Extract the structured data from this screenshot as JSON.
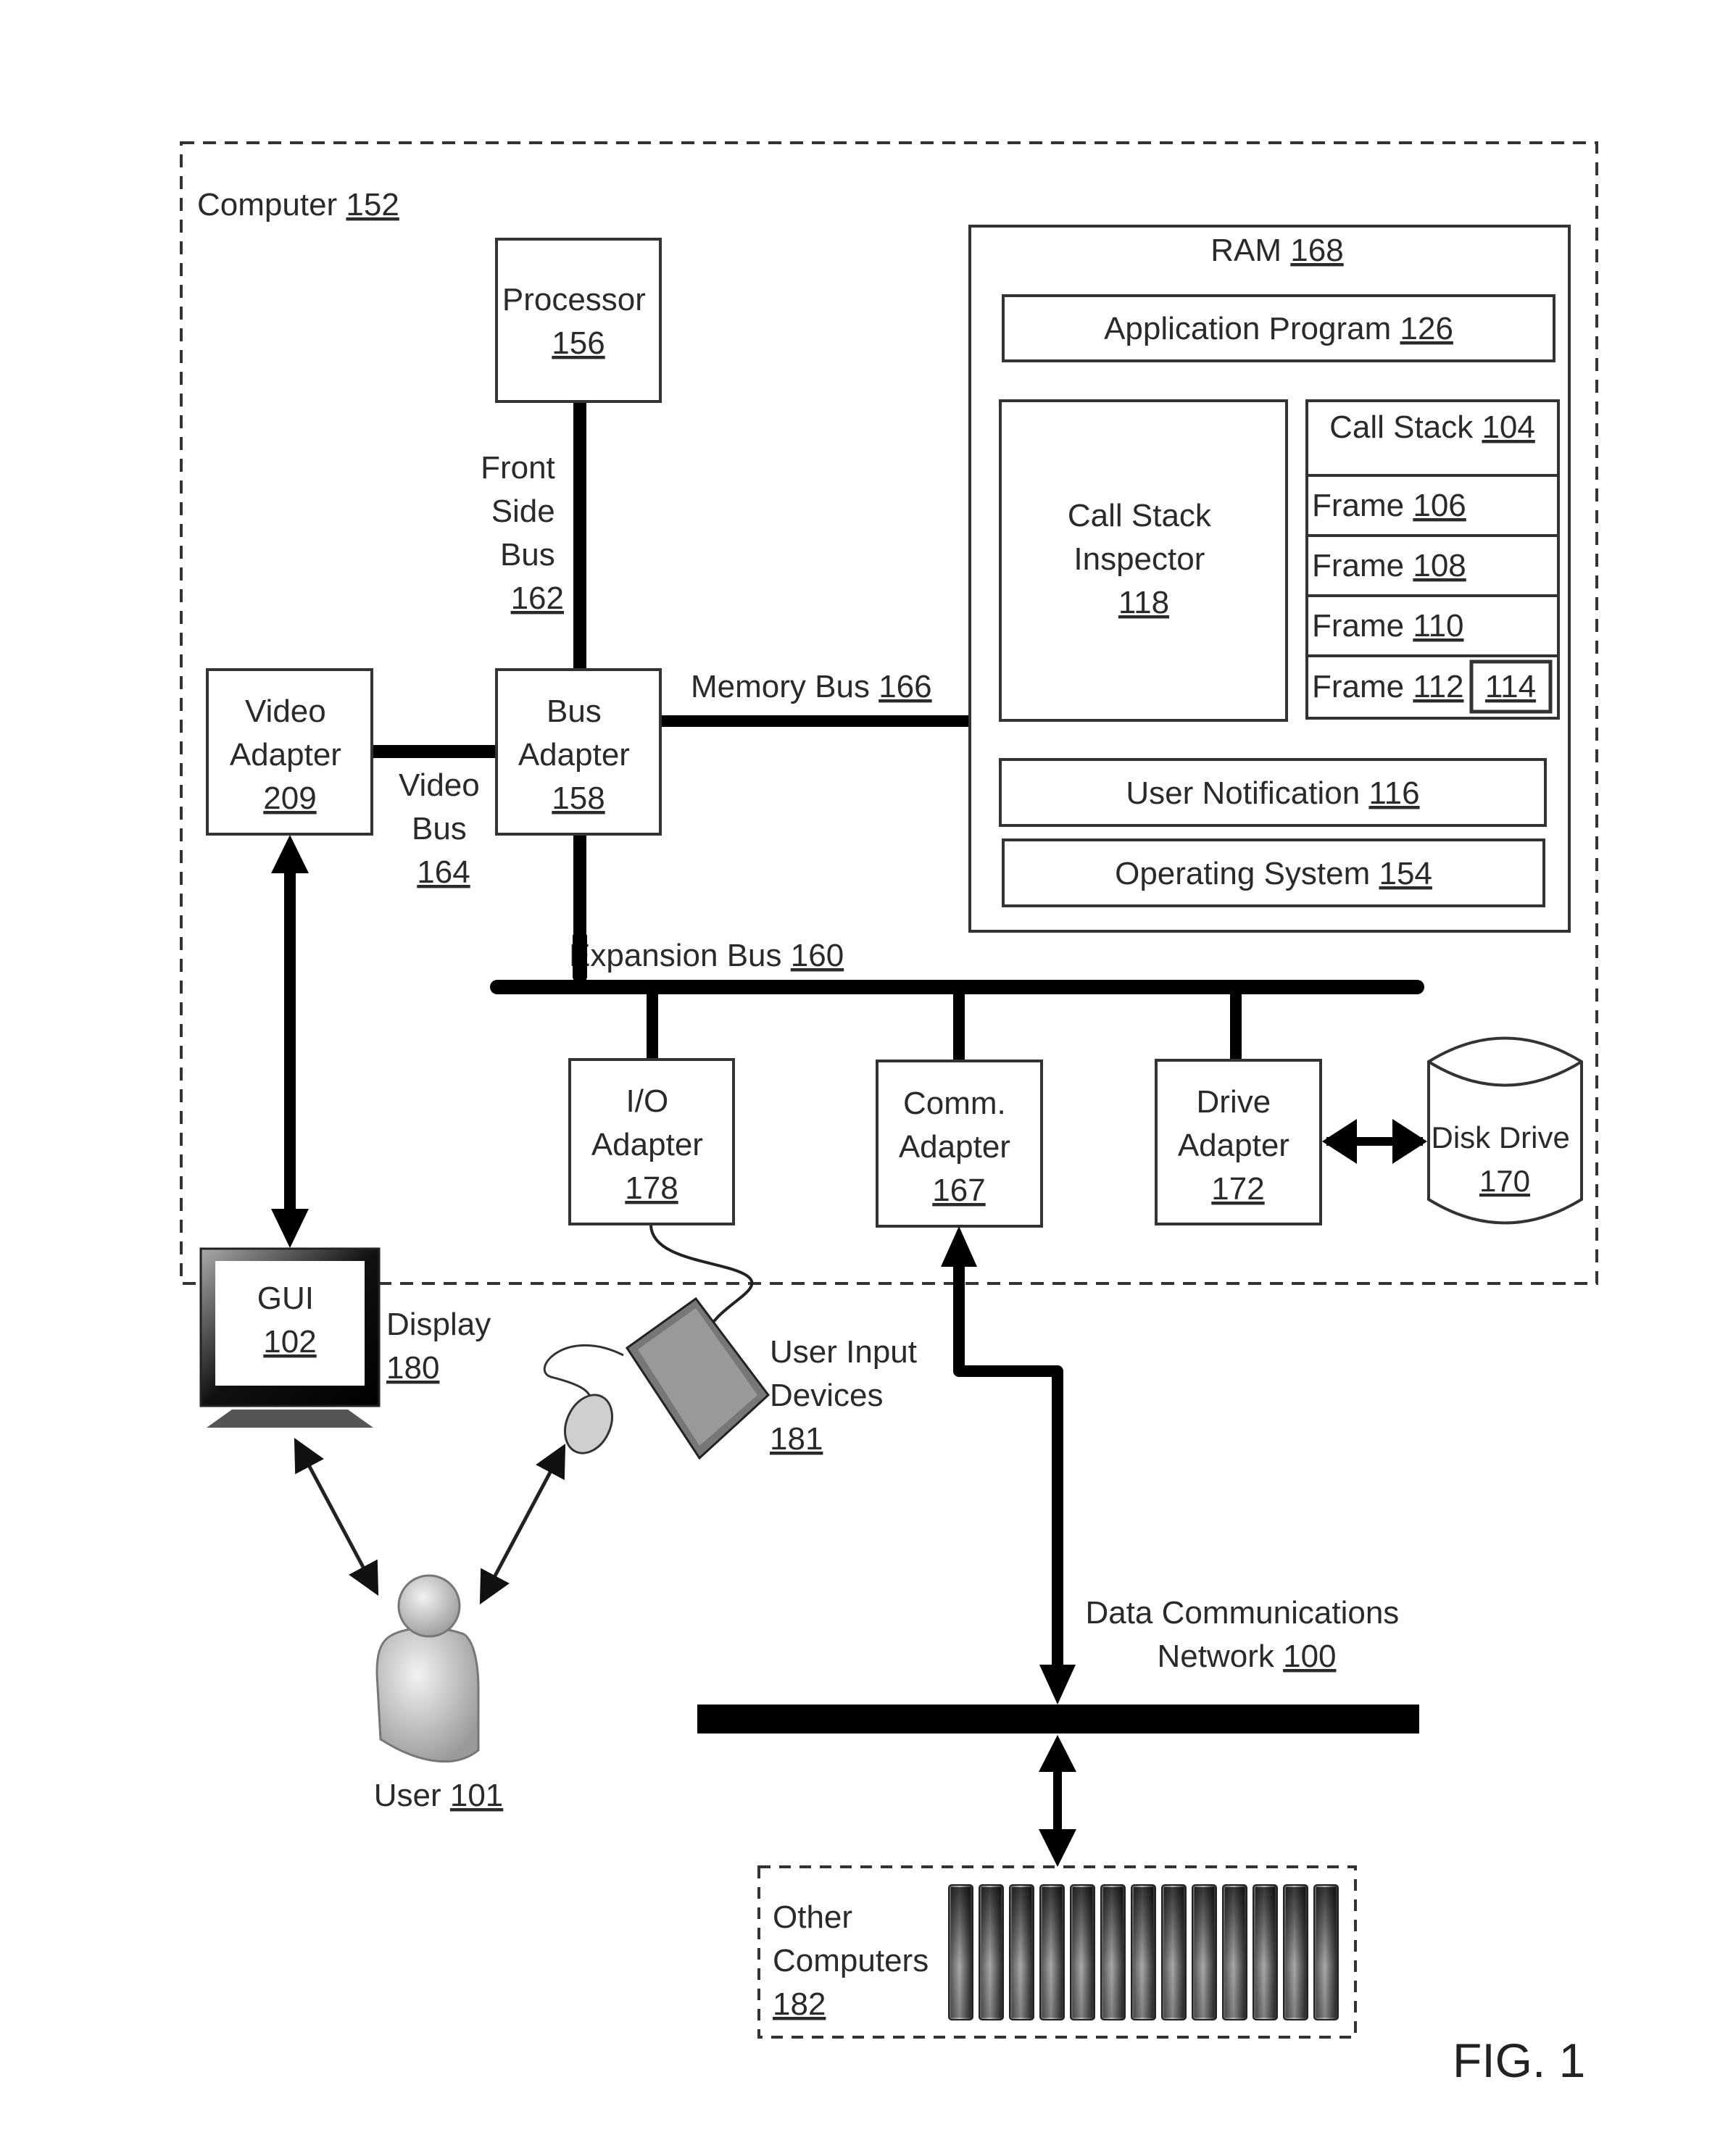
{
  "figure": {
    "label": "FIG. 1",
    "computer": {
      "name": "Computer",
      "ref": "152"
    },
    "processor": {
      "lines": [
        "Processor"
      ],
      "ref": "156"
    },
    "front_side_bus": {
      "lines": [
        "Front",
        "Side",
        "Bus"
      ],
      "ref": "162"
    },
    "bus_adapter": {
      "lines": [
        "Bus",
        "Adapter"
      ],
      "ref": "158"
    },
    "video_adapter": {
      "lines": [
        "Video",
        "Adapter"
      ],
      "ref": "209"
    },
    "video_bus": {
      "lines": [
        "Video",
        "Bus"
      ],
      "ref": "164"
    },
    "memory_bus": {
      "name": "Memory Bus",
      "ref": "166"
    },
    "expansion_bus": {
      "name": "Expansion Bus",
      "ref": "160"
    },
    "ram": {
      "name": "RAM",
      "ref": "168",
      "application_program": {
        "name": "Application Program",
        "ref": "126"
      },
      "call_stack_inspector": {
        "lines": [
          "Call Stack",
          "Inspector"
        ],
        "ref": "118"
      },
      "call_stack": {
        "name": "Call Stack",
        "ref": "104",
        "frames": [
          {
            "name": "Frame",
            "ref": "106"
          },
          {
            "name": "Frame",
            "ref": "108"
          },
          {
            "name": "Frame",
            "ref": "110"
          },
          {
            "name": "Frame",
            "ref": "112",
            "inner_ref": "114"
          }
        ]
      },
      "user_notification": {
        "name": "User Notification",
        "ref": "116"
      },
      "operating_system": {
        "name": "Operating System",
        "ref": "154"
      }
    },
    "io_adapter": {
      "lines": [
        "I/O",
        "Adapter"
      ],
      "ref": "178"
    },
    "comm_adapter": {
      "lines": [
        "Comm.",
        "Adapter"
      ],
      "ref": "167"
    },
    "drive_adapter": {
      "lines": [
        "Drive",
        "Adapter"
      ],
      "ref": "172"
    },
    "disk_drive": {
      "name": "Disk Drive",
      "ref": "170"
    },
    "display": {
      "gui_name": "GUI",
      "gui_ref": "102",
      "name": "Display",
      "ref": "180"
    },
    "user_input_devices": {
      "lines": [
        "User Input",
        "Devices"
      ],
      "ref": "181"
    },
    "user": {
      "name": "User",
      "ref": "101"
    },
    "network": {
      "lines": [
        "Data Communications"
      ],
      "name": "Network",
      "ref": "100"
    },
    "other_computers": {
      "lines": [
        "Other",
        "Computers"
      ],
      "ref": "182",
      "count": 13
    }
  }
}
